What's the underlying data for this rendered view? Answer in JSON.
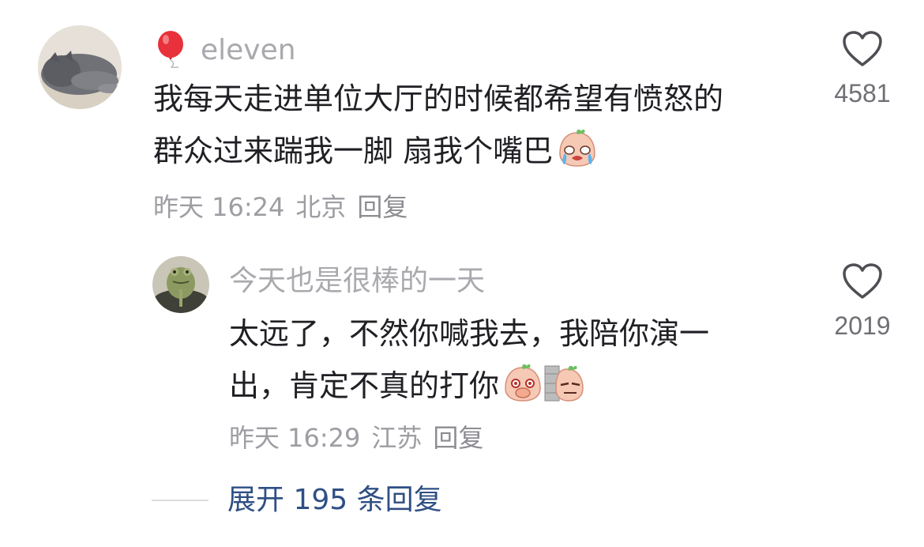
{
  "comments": [
    {
      "username": "eleven",
      "text_lines": [
        "我每天走进单位大厅的时候都希望有愤怒的",
        "群众过来踹我一脚 扇我个嘴巴"
      ],
      "time": "昨天 16:24",
      "location": "北京",
      "reply_label": "回复",
      "like_count": "4581",
      "badge_icon": "balloon-icon",
      "emoji_icons": [
        "crying-peach-emoji"
      ]
    },
    {
      "username": "今天也是很棒的一天",
      "text_lines": [
        "太远了，不然你喊我去，我陪你演一",
        "出，肯定不真的打你"
      ],
      "time": "昨天 16:29",
      "location": "江苏",
      "reply_label": "回复",
      "like_count": "2019",
      "emoji_icons": [
        "snicker-peach-emoji",
        "peeking-peach-emoji"
      ]
    }
  ],
  "expand": {
    "label": "展开 195 条回复"
  },
  "colors": {
    "username": "#a9a9ae",
    "text": "#1f1f24",
    "meta": "#9d9da3",
    "expand": "#2f4f84",
    "balloon": "#e8313a"
  }
}
